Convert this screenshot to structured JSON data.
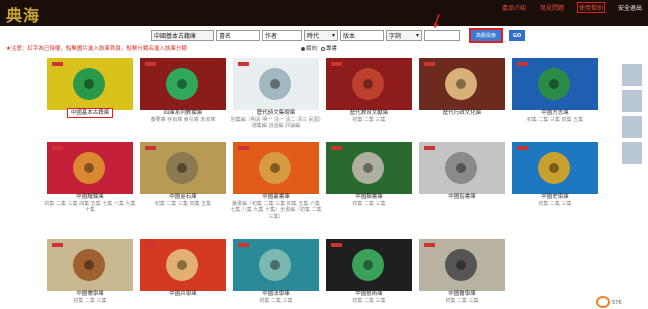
{
  "header": {
    "logo": "典海",
    "nav": [
      {
        "label": "產品介紹",
        "plain": false,
        "highlight": false
      },
      {
        "label": "常見問題",
        "plain": false,
        "highlight": false
      },
      {
        "label": "使用幫助",
        "plain": false,
        "highlight": true
      },
      {
        "label": "安全退出",
        "plain": true,
        "highlight": false
      }
    ]
  },
  "search": {
    "library_value": "中國基本古籍庫",
    "title_placeholder": "書名",
    "author_placeholder": "作者",
    "era_value": "時代",
    "edition_placeholder": "版本",
    "word_value": "字詞",
    "advanced_label": "高級檢索",
    "go_label": "GO"
  },
  "note": "★注意：紅字為已授權，點擊圖片進入該庫首頁。點擊分類名進入該庫分類",
  "radios": {
    "opt1": "縱向",
    "opt2": "專書"
  },
  "tiles": [
    {
      "title": "中國基本古籍庫",
      "sub": "",
      "bg": "#d9c21c",
      "disc": "#2a9a4a",
      "text": "#1b6b2b",
      "first": true
    },
    {
      "title": "四庫系列數據庫",
      "sub": "薈要庫 存目庫 索引庫 未收庫",
      "bg": "#8a1d1a",
      "disc": "#2fa85a",
      "text": "#f3d67a",
      "first": false
    },
    {
      "title": "歷代詩文集總庫",
      "sub": "別集編（明清 明一 清一 清二 清三 民國）總集編 詩話編 評論編",
      "bg": "#e9eef0",
      "disc": "#a0b8c0",
      "text": "#555555",
      "first": false
    },
    {
      "title": "歷代教育文獻庫",
      "sub": "初集 二集 三集",
      "bg": "#8f1c1c",
      "disc": "#c04030",
      "text": "#f3d67a",
      "first": false
    },
    {
      "title": "歷代行政文化庫",
      "sub": "",
      "bg": "#6d2a1e",
      "disc": "#d9b07a",
      "text": "#f3d67a",
      "first": false
    },
    {
      "title": "中國方志庫",
      "sub": "初集 二集 三集 四集 五集",
      "bg": "#1f5fb0",
      "disc": "#2a8a48",
      "text": "#ffffff",
      "first": false
    },
    {
      "title": "中國譜牒庫",
      "sub": "初集 二集 三集 四集 五集 七集 八集 九集 十集",
      "bg": "#c4203a",
      "disc": "#d98a30",
      "text": "#ffffff",
      "first": false
    },
    {
      "title": "中國金石庫",
      "sub": "初集 二集 三集 四集 五集",
      "bg": "#b89a55",
      "disc": "#8a7a50",
      "text": "#ffffff",
      "first": false
    },
    {
      "title": "中國叢書庫",
      "sub": "叢書編（初集 二集 三集 四集 五集 六集 七集 八集 九集 十集）全書編（初集 二集 三集）",
      "bg": "#e05a18",
      "disc": "#d89a40",
      "text": "#ffffff",
      "first": false
    },
    {
      "title": "中國類書庫",
      "sub": "初集 二集 三集",
      "bg": "#2b6a2e",
      "disc": "#b0b0a0",
      "text": "#ffffff",
      "first": false
    },
    {
      "title": "中國俗書庫",
      "sub": "",
      "bg": "#c4c4c4",
      "disc": "#8a8a8a",
      "text": "#333333",
      "first": false
    },
    {
      "title": "中國史學庫",
      "sub": "初集 二集 三集",
      "bg": "#1e78c0",
      "disc": "#c8a030",
      "text": "#f3d67a",
      "first": false
    },
    {
      "title": "中國儒學庫",
      "sub": "初集 二集 三集",
      "bg": "#c9b890",
      "disc": "#a06030",
      "text": "#7a2a1a",
      "first": false
    },
    {
      "title": "中國兵學庫",
      "sub": "",
      "bg": "#d43a20",
      "disc": "#e2b070",
      "text": "#ffffff",
      "first": false
    },
    {
      "title": "中國法學庫",
      "sub": "初集 二集 三集",
      "bg": "#2a8a98",
      "disc": "#7ab8b0",
      "text": "#ffffff",
      "first": false
    },
    {
      "title": "中國藝術庫",
      "sub": "初集 二集 三集",
      "bg": "#1f1f1f",
      "disc": "#3aa05a",
      "text": "#ffffff",
      "first": false
    },
    {
      "title": "中國醫學庫",
      "sub": "初集 二集 三集",
      "bg": "#b8b2a0",
      "disc": "#555555",
      "text": "#222222",
      "first": false
    }
  ],
  "badge_text": "57K"
}
